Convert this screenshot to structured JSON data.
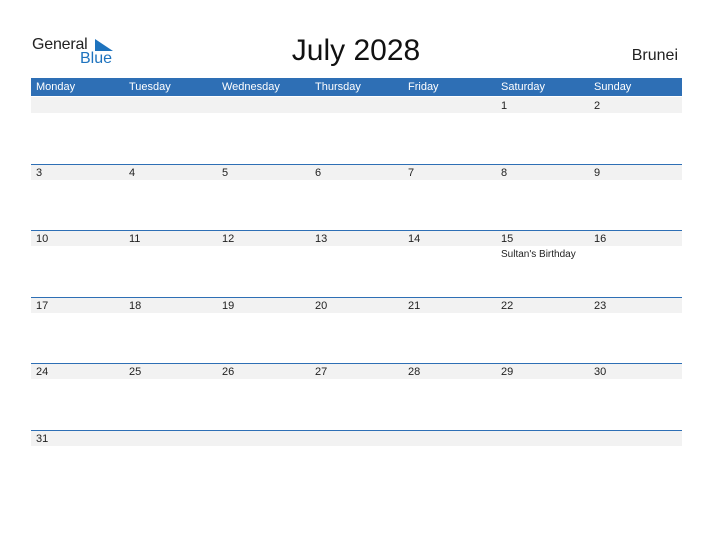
{
  "logo": {
    "general": "General",
    "blue": "Blue"
  },
  "title": "July 2028",
  "country": "Brunei",
  "accent_color": "#2e6fb5",
  "weekdays": [
    "Monday",
    "Tuesday",
    "Wednesday",
    "Thursday",
    "Friday",
    "Saturday",
    "Sunday"
  ],
  "weeks": [
    [
      {
        "day": ""
      },
      {
        "day": ""
      },
      {
        "day": ""
      },
      {
        "day": ""
      },
      {
        "day": ""
      },
      {
        "day": "1"
      },
      {
        "day": "2"
      }
    ],
    [
      {
        "day": "3"
      },
      {
        "day": "4"
      },
      {
        "day": "5"
      },
      {
        "day": "6"
      },
      {
        "day": "7"
      },
      {
        "day": "8"
      },
      {
        "day": "9"
      }
    ],
    [
      {
        "day": "10"
      },
      {
        "day": "11"
      },
      {
        "day": "12"
      },
      {
        "day": "13"
      },
      {
        "day": "14"
      },
      {
        "day": "15",
        "event": "Sultan's Birthday"
      },
      {
        "day": "16"
      }
    ],
    [
      {
        "day": "17"
      },
      {
        "day": "18"
      },
      {
        "day": "19"
      },
      {
        "day": "20"
      },
      {
        "day": "21"
      },
      {
        "day": "22"
      },
      {
        "day": "23"
      }
    ],
    [
      {
        "day": "24"
      },
      {
        "day": "25"
      },
      {
        "day": "26"
      },
      {
        "day": "27"
      },
      {
        "day": "28"
      },
      {
        "day": "29"
      },
      {
        "day": "30"
      }
    ],
    [
      {
        "day": "31"
      },
      {
        "day": ""
      },
      {
        "day": ""
      },
      {
        "day": ""
      },
      {
        "day": ""
      },
      {
        "day": ""
      },
      {
        "day": ""
      }
    ]
  ]
}
